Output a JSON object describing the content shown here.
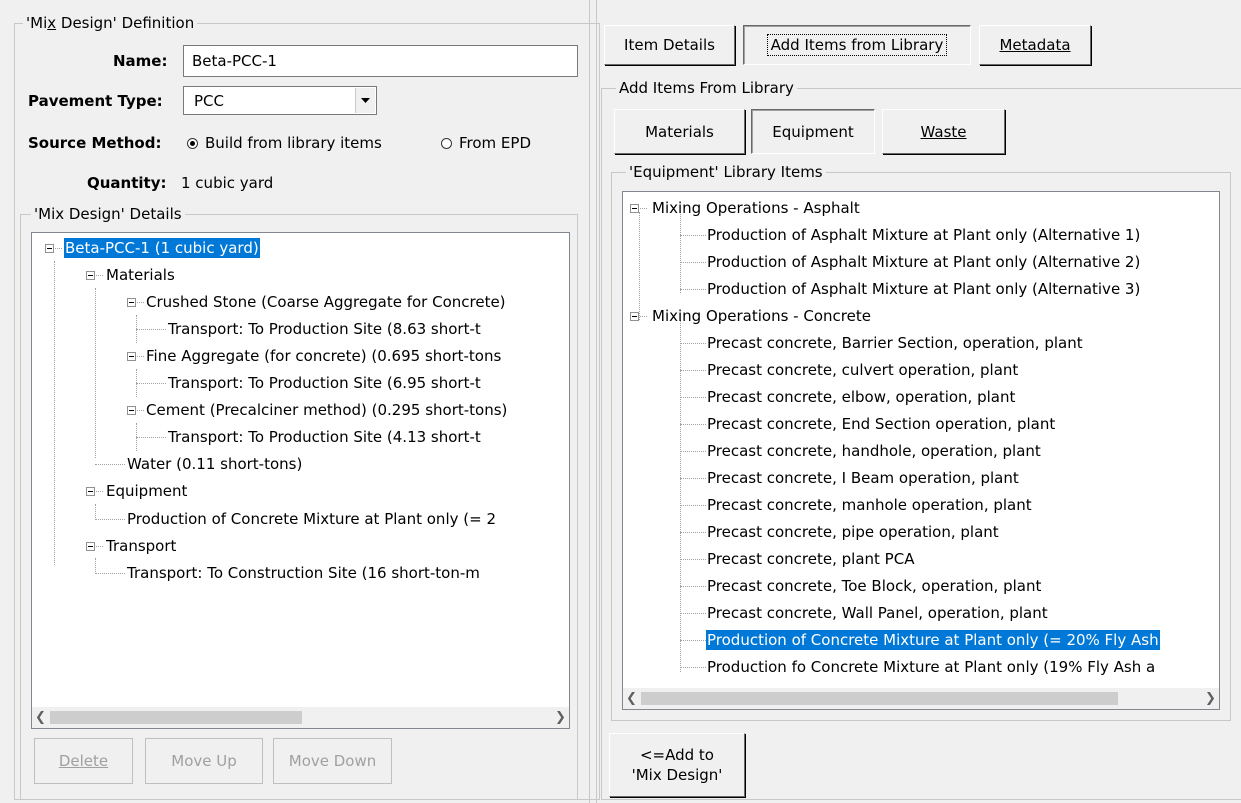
{
  "definition": {
    "group_title": "'Mix Design' Definition",
    "name_label": "Name:",
    "name_value": "Beta-PCC-1",
    "pavement_label": "Pavement Type:",
    "pavement_value": "PCC",
    "source_label": "Source Method:",
    "source_options": [
      "Build from library items",
      "From EPD"
    ],
    "source_selected": "Build from library items",
    "quantity_label": "Quantity:",
    "quantity_value": "1 cubic yard"
  },
  "details": {
    "group_title": "'Mix Design' Details",
    "tree": [
      {
        "text": "Beta-PCC-1 (1 cubic yard)",
        "selected": true
      },
      {
        "text": "Materials"
      },
      {
        "text": "Crushed Stone (Coarse Aggregate for Concrete)"
      },
      {
        "text": "Transport: To Production Site (8.63 short-t"
      },
      {
        "text": "Fine Aggregate (for concrete) (0.695 short-tons"
      },
      {
        "text": "Transport: To Production Site (6.95 short-t"
      },
      {
        "text": "Cement (Precalciner method) (0.295 short-tons)"
      },
      {
        "text": "Transport: To Production Site (4.13 short-t"
      },
      {
        "text": "Water (0.11 short-tons)"
      },
      {
        "text": "Equipment"
      },
      {
        "text": "Production of Concrete Mixture at Plant only (= 2"
      },
      {
        "text": "Transport"
      },
      {
        "text": "Transport: To Construction Site (16 short-ton-m"
      }
    ],
    "buttons": {
      "delete": "Delete",
      "move_up": "Move Up",
      "move_down": "Move Down"
    }
  },
  "top_tabs": {
    "item_details": "Item Details",
    "add_items": "Add Items from Library",
    "metadata": "Metadata"
  },
  "library": {
    "group_title": "Add Items From Library",
    "tabs": {
      "materials": "Materials",
      "equipment": "Equipment",
      "waste": "Waste"
    },
    "items_title": "'Equipment' Library Items",
    "tree": [
      {
        "text": "Mixing Operations - Asphalt"
      },
      {
        "text": "Production of Asphalt Mixture at Plant only (Alternative 1)"
      },
      {
        "text": "Production of Asphalt Mixture at Plant only (Alternative 2)"
      },
      {
        "text": "Production of Asphalt Mixture at Plant only (Alternative 3)"
      },
      {
        "text": "Mixing Operations - Concrete"
      },
      {
        "text": "Precast concrete, Barrier Section, operation, plant"
      },
      {
        "text": "Precast concrete, culvert operation, plant"
      },
      {
        "text": "Precast concrete, elbow, operation, plant"
      },
      {
        "text": "Precast concrete, End Section operation, plant"
      },
      {
        "text": "Precast concrete, handhole, operation, plant"
      },
      {
        "text": "Precast concrete, I Beam operation, plant"
      },
      {
        "text": "Precast concrete, manhole operation, plant"
      },
      {
        "text": "Precast concrete, pipe operation, plant"
      },
      {
        "text": "Precast concrete, plant PCA"
      },
      {
        "text": "Precast concrete, Toe Block, operation, plant"
      },
      {
        "text": "Precast concrete, Wall Panel, operation, plant"
      },
      {
        "text": "Production of Concrete Mixture at Plant only (= 20% Fly Ash",
        "selected": true
      },
      {
        "text": "Production fo Concrete Mixture at Plant only (19% Fly Ash a"
      }
    ],
    "add_button": [
      "<=Add to",
      "'Mix Design'"
    ]
  },
  "colors": {
    "selection": "#0078d7",
    "window_bg": "#f0f0f0"
  }
}
